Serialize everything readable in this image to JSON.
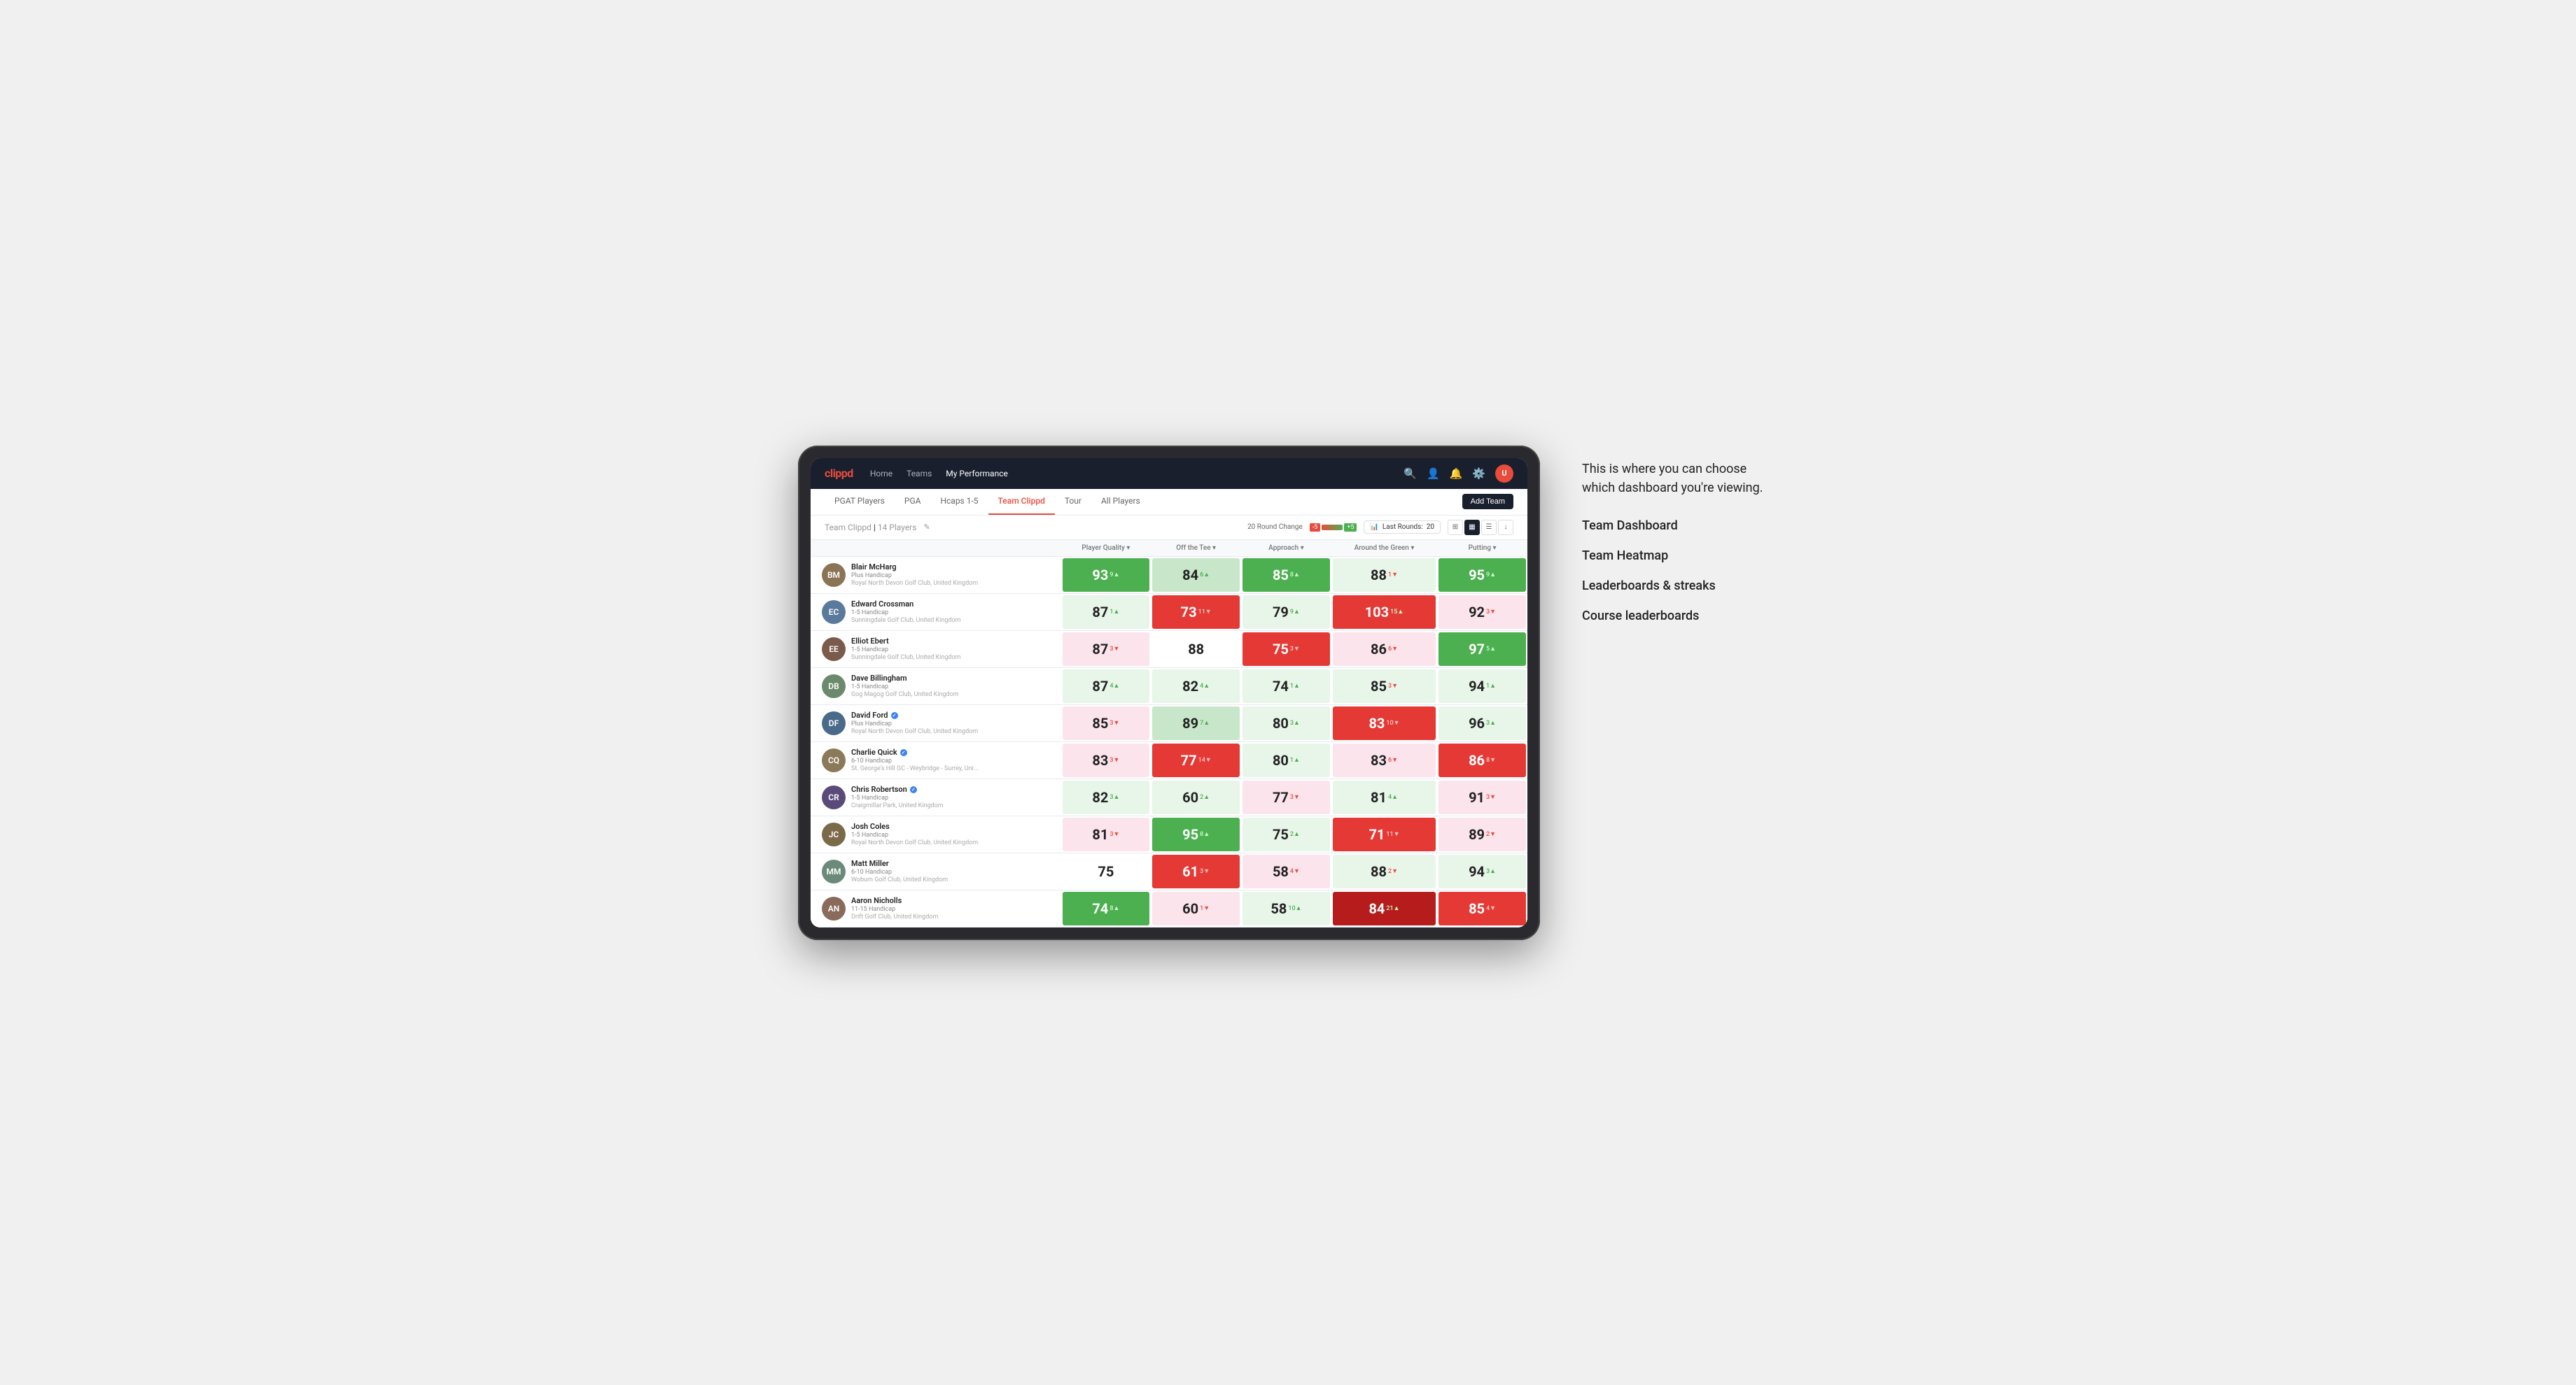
{
  "annotation": {
    "description": "This is where you can choose which dashboard you're viewing.",
    "items": [
      "Team Dashboard",
      "Team Heatmap",
      "Leaderboards & streaks",
      "Course leaderboards"
    ]
  },
  "topnav": {
    "logo": "clippd",
    "links": [
      "Home",
      "Teams",
      "My Performance"
    ],
    "active_link": "My Performance"
  },
  "subnav": {
    "tabs": [
      "PGAT Players",
      "PGA",
      "Hcaps 1-5",
      "Team Clippd",
      "Tour",
      "All Players"
    ],
    "active_tab": "Team Clippd",
    "add_team_label": "Add Team"
  },
  "team_header": {
    "title": "Team Clippd",
    "player_count": "14 Players",
    "round_change_label": "20 Round Change",
    "change_neg": "-5",
    "change_pos": "+5",
    "last_rounds_label": "Last Rounds:",
    "last_rounds_value": "20"
  },
  "table": {
    "column_headers": [
      "Player Quality ▾",
      "Off the Tee ▾",
      "Approach ▾",
      "Around the Green ▾",
      "Putting ▾"
    ],
    "rows": [
      {
        "name": "Blair McHarg",
        "handicap": "Plus Handicap",
        "club": "Royal North Devon Golf Club, United Kingdom",
        "avatar_color": "#8b7355",
        "initials": "BM",
        "scores": [
          {
            "value": "93",
            "change": "9",
            "dir": "up",
            "bg": "bg-green"
          },
          {
            "value": "84",
            "change": "6",
            "dir": "up",
            "bg": "bg-light-green"
          },
          {
            "value": "85",
            "change": "8",
            "dir": "up",
            "bg": "bg-green"
          },
          {
            "value": "88",
            "change": "1",
            "dir": "down",
            "bg": "bg-pale-green"
          },
          {
            "value": "95",
            "change": "9",
            "dir": "up",
            "bg": "bg-green"
          }
        ]
      },
      {
        "name": "Edward Crossman",
        "handicap": "1-5 Handicap",
        "club": "Sunningdale Golf Club, United Kingdom",
        "avatar_color": "#5a7a9b",
        "initials": "EC",
        "verified": false,
        "scores": [
          {
            "value": "87",
            "change": "1",
            "dir": "up",
            "bg": "bg-pale-green"
          },
          {
            "value": "73",
            "change": "11",
            "dir": "down",
            "bg": "bg-red"
          },
          {
            "value": "79",
            "change": "9",
            "dir": "up",
            "bg": "bg-pale-green"
          },
          {
            "value": "103",
            "change": "15",
            "dir": "up",
            "bg": "bg-red"
          },
          {
            "value": "92",
            "change": "3",
            "dir": "down",
            "bg": "bg-pale-red"
          }
        ]
      },
      {
        "name": "Elliot Ebert",
        "handicap": "1-5 Handicap",
        "club": "Sunningdale Golf Club, United Kingdom",
        "avatar_color": "#7a5a4a",
        "initials": "EE",
        "scores": [
          {
            "value": "87",
            "change": "3",
            "dir": "down",
            "bg": "bg-pale-red"
          },
          {
            "value": "88",
            "change": "",
            "dir": "",
            "bg": "bg-white"
          },
          {
            "value": "75",
            "change": "3",
            "dir": "down",
            "bg": "bg-red"
          },
          {
            "value": "86",
            "change": "6",
            "dir": "down",
            "bg": "bg-pale-red"
          },
          {
            "value": "97",
            "change": "5",
            "dir": "up",
            "bg": "bg-green"
          }
        ]
      },
      {
        "name": "Dave Billingham",
        "handicap": "1-5 Handicap",
        "club": "Gog Magog Golf Club, United Kingdom",
        "avatar_color": "#6b8a6b",
        "initials": "DB",
        "scores": [
          {
            "value": "87",
            "change": "4",
            "dir": "up",
            "bg": "bg-pale-green"
          },
          {
            "value": "82",
            "change": "4",
            "dir": "up",
            "bg": "bg-pale-green"
          },
          {
            "value": "74",
            "change": "1",
            "dir": "up",
            "bg": "bg-pale-green"
          },
          {
            "value": "85",
            "change": "3",
            "dir": "down",
            "bg": "bg-pale-green"
          },
          {
            "value": "94",
            "change": "1",
            "dir": "up",
            "bg": "bg-pale-green"
          }
        ]
      },
      {
        "name": "David Ford",
        "handicap": "Plus Handicap",
        "club": "Royal North Devon Golf Club, United Kingdom",
        "avatar_color": "#4a6a8a",
        "initials": "DF",
        "verified": true,
        "scores": [
          {
            "value": "85",
            "change": "3",
            "dir": "down",
            "bg": "bg-pale-red"
          },
          {
            "value": "89",
            "change": "7",
            "dir": "up",
            "bg": "bg-light-green"
          },
          {
            "value": "80",
            "change": "3",
            "dir": "up",
            "bg": "bg-pale-green"
          },
          {
            "value": "83",
            "change": "10",
            "dir": "down",
            "bg": "bg-red"
          },
          {
            "value": "96",
            "change": "3",
            "dir": "up",
            "bg": "bg-pale-green"
          }
        ]
      },
      {
        "name": "Charlie Quick",
        "handicap": "6-10 Handicap",
        "club": "St. George's Hill GC - Weybridge - Surrey, Uni...",
        "avatar_color": "#8a7a5a",
        "initials": "CQ",
        "verified": true,
        "scores": [
          {
            "value": "83",
            "change": "3",
            "dir": "down",
            "bg": "bg-pale-red"
          },
          {
            "value": "77",
            "change": "14",
            "dir": "down",
            "bg": "bg-red"
          },
          {
            "value": "80",
            "change": "1",
            "dir": "up",
            "bg": "bg-pale-green"
          },
          {
            "value": "83",
            "change": "6",
            "dir": "down",
            "bg": "bg-pale-red"
          },
          {
            "value": "86",
            "change": "8",
            "dir": "down",
            "bg": "bg-red"
          }
        ]
      },
      {
        "name": "Chris Robertson",
        "handicap": "1-5 Handicap",
        "club": "Craigmillar Park, United Kingdom",
        "avatar_color": "#5a4a7a",
        "initials": "CR",
        "verified": true,
        "scores": [
          {
            "value": "82",
            "change": "3",
            "dir": "up",
            "bg": "bg-pale-green"
          },
          {
            "value": "60",
            "change": "2",
            "dir": "up",
            "bg": "bg-pale-green"
          },
          {
            "value": "77",
            "change": "3",
            "dir": "down",
            "bg": "bg-pale-red"
          },
          {
            "value": "81",
            "change": "4",
            "dir": "up",
            "bg": "bg-pale-green"
          },
          {
            "value": "91",
            "change": "3",
            "dir": "down",
            "bg": "bg-pale-red"
          }
        ]
      },
      {
        "name": "Josh Coles",
        "handicap": "1-5 Handicap",
        "club": "Royal North Devon Golf Club, United Kingdom",
        "avatar_color": "#7a6a4a",
        "initials": "JC",
        "scores": [
          {
            "value": "81",
            "change": "3",
            "dir": "down",
            "bg": "bg-pale-red"
          },
          {
            "value": "95",
            "change": "8",
            "dir": "up",
            "bg": "bg-green"
          },
          {
            "value": "75",
            "change": "2",
            "dir": "up",
            "bg": "bg-pale-green"
          },
          {
            "value": "71",
            "change": "11",
            "dir": "down",
            "bg": "bg-red"
          },
          {
            "value": "89",
            "change": "2",
            "dir": "down",
            "bg": "bg-pale-red"
          }
        ]
      },
      {
        "name": "Matt Miller",
        "handicap": "6-10 Handicap",
        "club": "Woburn Golf Club, United Kingdom",
        "avatar_color": "#6a8a7a",
        "initials": "MM",
        "scores": [
          {
            "value": "75",
            "change": "",
            "dir": "",
            "bg": "bg-white"
          },
          {
            "value": "61",
            "change": "3",
            "dir": "down",
            "bg": "bg-red"
          },
          {
            "value": "58",
            "change": "4",
            "dir": "down",
            "bg": "bg-pale-red"
          },
          {
            "value": "88",
            "change": "2",
            "dir": "down",
            "bg": "bg-pale-green"
          },
          {
            "value": "94",
            "change": "3",
            "dir": "up",
            "bg": "bg-pale-green"
          }
        ]
      },
      {
        "name": "Aaron Nicholls",
        "handicap": "11-15 Handicap",
        "club": "Drift Golf Club, United Kingdom",
        "avatar_color": "#8a6a5a",
        "initials": "AN",
        "scores": [
          {
            "value": "74",
            "change": "8",
            "dir": "up",
            "bg": "bg-green"
          },
          {
            "value": "60",
            "change": "1",
            "dir": "down",
            "bg": "bg-pale-red"
          },
          {
            "value": "58",
            "change": "10",
            "dir": "up",
            "bg": "bg-pale-green"
          },
          {
            "value": "84",
            "change": "21",
            "dir": "up",
            "bg": "bg-dark-red"
          },
          {
            "value": "85",
            "change": "4",
            "dir": "down",
            "bg": "bg-red"
          }
        ]
      }
    ]
  }
}
